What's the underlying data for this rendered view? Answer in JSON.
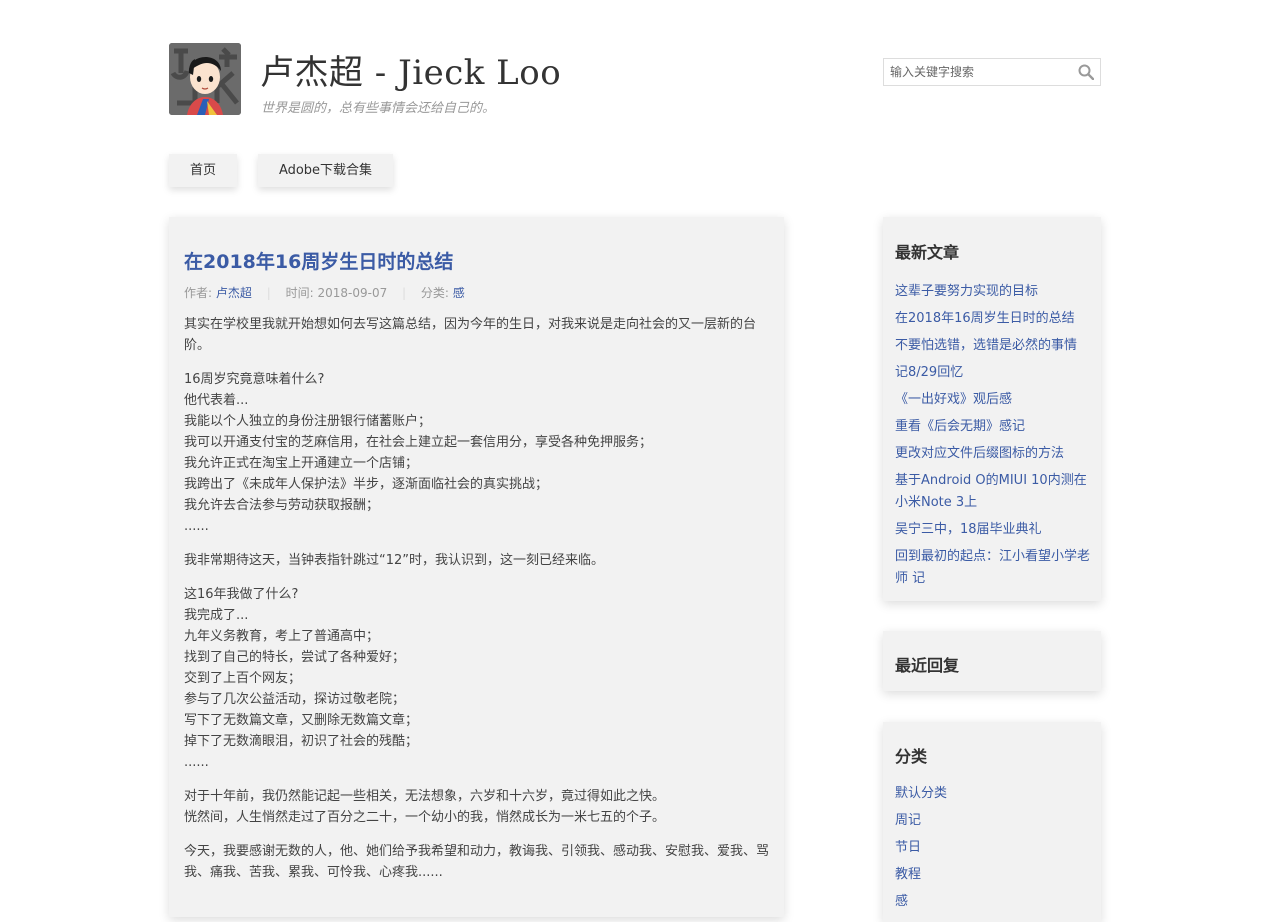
{
  "header": {
    "title": "卢杰超 - Jieck Loo",
    "tagline": "世界是圆的，总有些事情会还给自己的。",
    "search_placeholder": "输入关键字搜索"
  },
  "nav": {
    "home": "首页",
    "adobe": "Adobe下载合集"
  },
  "post": {
    "title": "在2018年16周岁生日时的总结",
    "author_label": "作者:",
    "author": "卢杰超",
    "time_label": "时间:",
    "time": "2018-09-07",
    "category_label": "分类:",
    "category": "感",
    "paragraphs": [
      "其实在学校里我就开始想如何去写这篇总结，因为今年的生日，对我来说是走向社会的又一层新的台阶。",
      "16周岁究竟意味着什么?\n他代表着...\n我能以个人独立的身份注册银行储蓄账户；\n我可以开通支付宝的芝麻信用，在社会上建立起一套信用分，享受各种免押服务；\n我允许正式在淘宝上开通建立一个店铺；\n我跨出了《未成年人保护法》半步，逐渐面临社会的真实挑战；\n我允许去合法参与劳动获取报酬；\n......",
      "我非常期待这天，当钟表指针跳过“12”时，我认识到，这一刻已经来临。",
      "这16年我做了什么?\n我完成了...\n九年义务教育，考上了普通高中；\n找到了自己的特长，尝试了各种爱好；\n交到了上百个网友；\n参与了几次公益活动，探访过敬老院；\n写下了无数篇文章，又删除无数篇文章；\n掉下了无数滴眼泪，初识了社会的残酷；\n......",
      "对于十年前，我仍然能记起一些相关，无法想象，六岁和十六岁，竟过得如此之快。\n恍然间，人生悄然走过了百分之二十，一个幼小的我，悄然成长为一米七五的个子。",
      "今天，我要感谢无数的人，他、她们给予我希望和动力，教诲我、引领我、感动我、安慰我、爱我、骂我、痛我、苦我、累我、可怜我、心疼我......"
    ]
  },
  "sidebar": {
    "latest_title": "最新文章",
    "latest": [
      "这辈子要努力实现的目标",
      "在2018年16周岁生日时的总结",
      "不要怕选错，选错是必然的事情",
      "记8/29回忆",
      "《一出好戏》观后感",
      "重看《后会无期》感记",
      "更改对应文件后缀图标的方法",
      "基于Android O的MIUI 10内测在小米Note 3上",
      "吴宁三中，18届毕业典礼",
      "回到最初的起点：江小看望小学老师 记"
    ],
    "replies_title": "最近回复",
    "categories_title": "分类",
    "categories": [
      "默认分类",
      "周记",
      "节日",
      "教程",
      "感"
    ]
  },
  "colors": {
    "link": "#3b5ba5",
    "card_bg": "#f2f2f2",
    "avatar_bg": "#6b6b6b"
  },
  "icons": {
    "search": "magnifier-icon",
    "avatar": "cartoon-avatar-icon"
  }
}
